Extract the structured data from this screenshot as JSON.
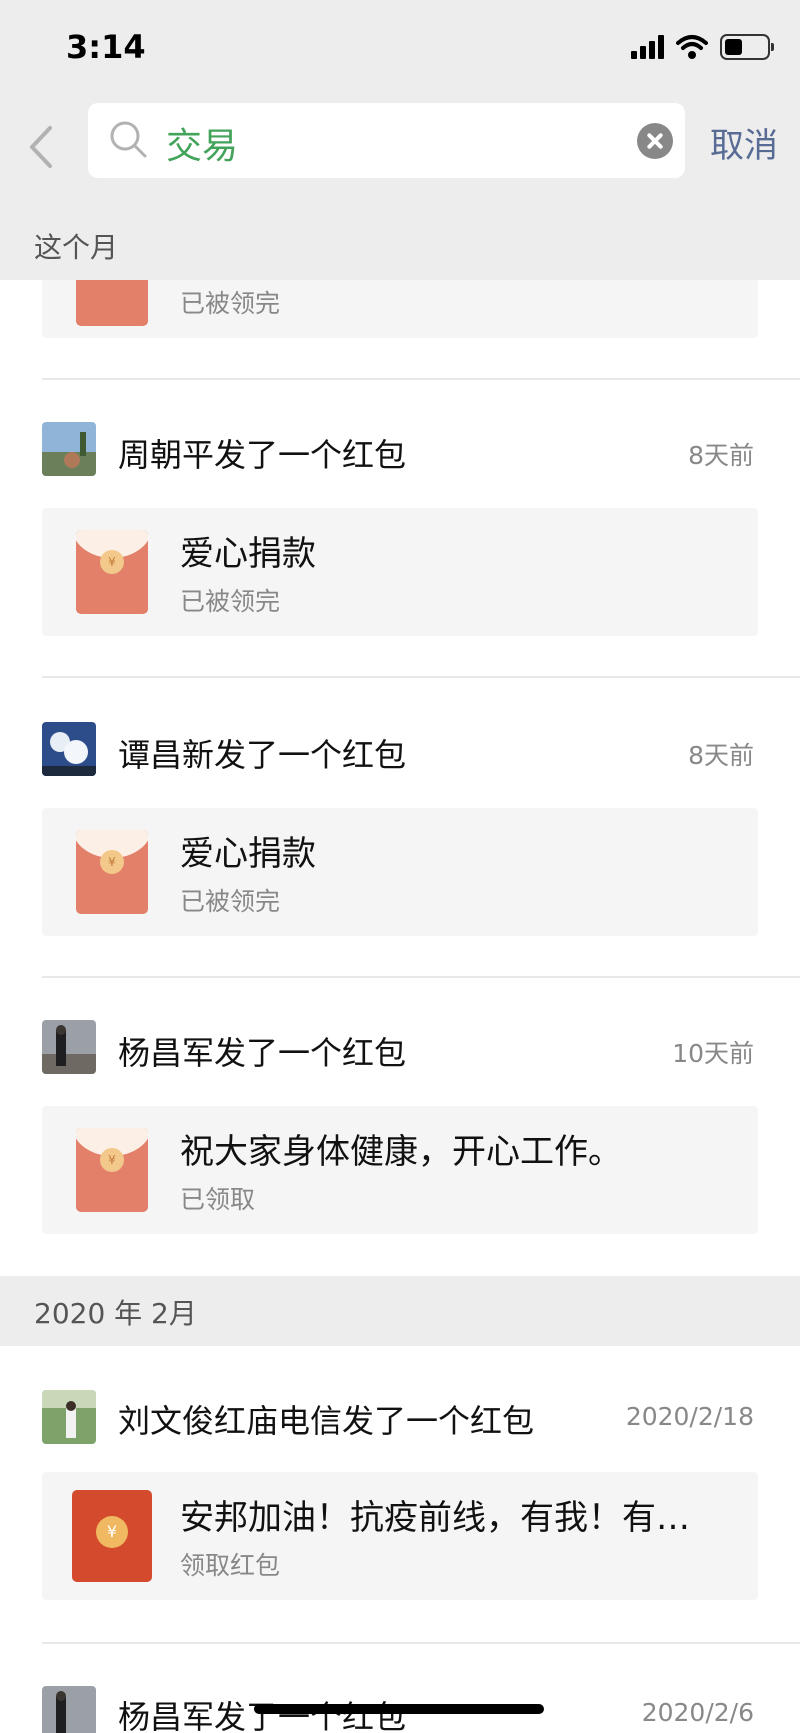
{
  "status_bar": {
    "time": "3:14"
  },
  "search": {
    "query": "交易",
    "cancel_label": "取消"
  },
  "sections": [
    {
      "label": "这个月"
    },
    {
      "label": "2020 年 2月"
    }
  ],
  "partial_item": {
    "status": "已被领完"
  },
  "items": [
    {
      "sender": "周朝平发了一个红包",
      "time": "8天前",
      "title": "爱心捐款",
      "status": "已被领完"
    },
    {
      "sender": "谭昌新发了一个红包",
      "time": "8天前",
      "title": "爱心捐款",
      "status": "已被领完"
    },
    {
      "sender": "杨昌军发了一个红包",
      "time": "10天前",
      "title": "祝大家身体健康，开心工作。",
      "status": "已领取"
    },
    {
      "sender": "刘文俊红庙电信发了一个红包",
      "time": "2020/2/18",
      "title": "安邦加油！抗疫前线，有我！有…",
      "status": "领取红包"
    },
    {
      "sender": "杨昌军发了一个红包",
      "time": "2020/2/6"
    }
  ],
  "icons": {
    "back": "chevron-left-icon",
    "search": "search-icon",
    "clear": "clear-icon",
    "envelope": "red-envelope-icon",
    "coin_symbol": "¥"
  },
  "colors": {
    "header_bg": "#ededed",
    "query_green": "#43a35b",
    "cancel_blue": "#576b95",
    "envelope_opened": "#e2806a",
    "envelope_unopened": "#d44a2c"
  }
}
